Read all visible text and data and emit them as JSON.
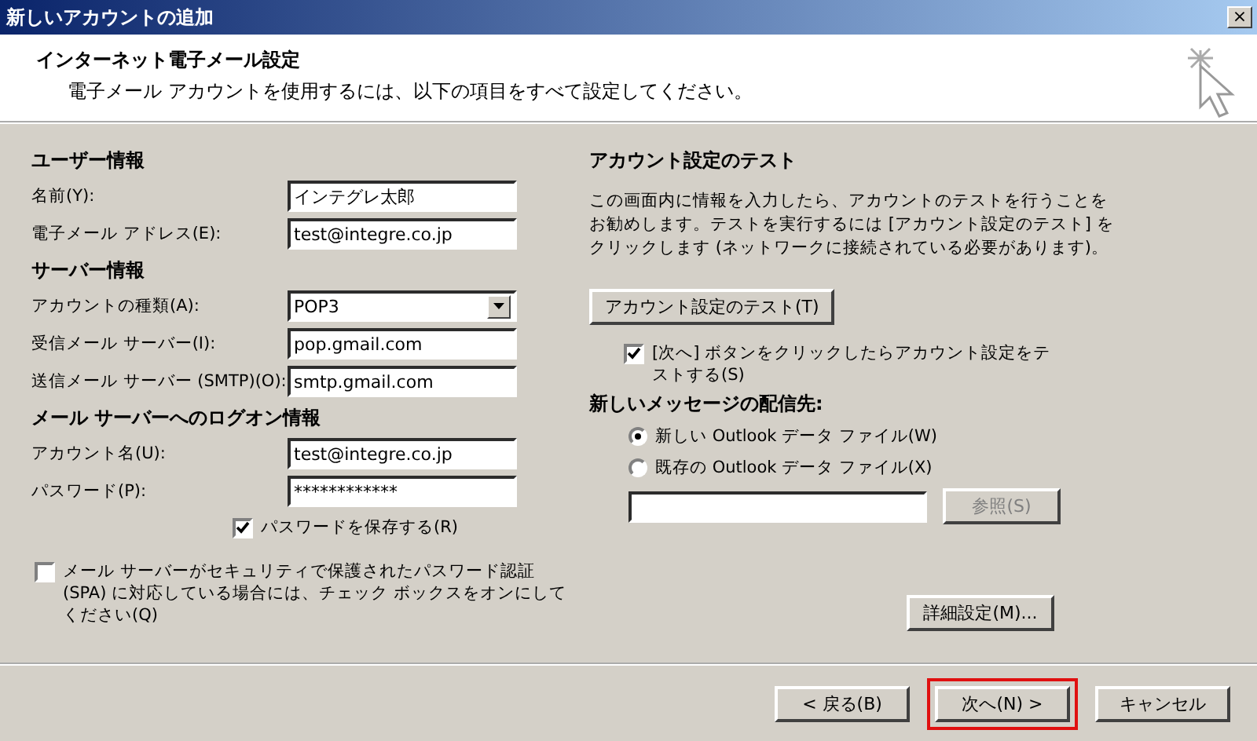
{
  "window": {
    "title": "新しいアカウントの追加",
    "close": "×"
  },
  "header": {
    "title": "インターネット電子メール設定",
    "subtitle": "電子メール アカウントを使用するには、以下の項目をすべて設定してください。"
  },
  "sections": [
    {
      "heading": "ユーザー情報",
      "fields": [
        {
          "label": "名前(Y):",
          "value": "インテグレ太郎",
          "kind": "text"
        },
        {
          "label": "電子メール アドレス(E):",
          "value": "test@integre.co.jp",
          "kind": "text"
        }
      ]
    },
    {
      "heading": "サーバー情報",
      "fields": [
        {
          "label": "アカウントの種類(A):",
          "value": "POP3",
          "kind": "select"
        },
        {
          "label": "受信メール サーバー(I):",
          "value": "pop.gmail.com",
          "kind": "text"
        },
        {
          "label": "送信メール サーバー (SMTP)(O):",
          "value": "smtp.gmail.com",
          "kind": "text"
        }
      ]
    },
    {
      "heading": "メール サーバーへのログオン情報",
      "fields": [
        {
          "label": "アカウント名(U):",
          "value": "test@integre.co.jp",
          "kind": "text"
        },
        {
          "label": "パスワード(P):",
          "value": "************",
          "kind": "text"
        }
      ]
    }
  ],
  "save_password": {
    "label": "パスワードを保存する(R)",
    "checked": true
  },
  "spa": {
    "label": "メール サーバーがセキュリティで保護されたパスワード認証 (SPA) に対応している場合には、チェック ボックスをオンにしてください(Q)",
    "checked": false
  },
  "test": {
    "heading": "アカウント設定のテスト",
    "description": "この画面内に情報を入力したら、アカウントのテストを行うことをお勧めします。テストを実行するには [アカウント設定のテスト] をクリックします (ネットワークに接続されている必要があります)。",
    "button": "アカウント設定のテスト(T)"
  },
  "test_on_next": {
    "label": "[次へ] ボタンをクリックしたらアカウント設定をテストする(S)",
    "checked": true
  },
  "delivery": {
    "heading": "新しいメッセージの配信先:",
    "options": [
      {
        "label": "新しい Outlook データ ファイル(W)",
        "selected": true
      },
      {
        "label": "既存の Outlook データ ファイル(X)",
        "selected": false
      }
    ],
    "browse_button": {
      "label": "参照(S)",
      "disabled": true
    }
  },
  "advanced_button": "詳細設定(M)...",
  "footer_buttons": [
    {
      "label": "< 戻る(B)",
      "highlighted": false
    },
    {
      "label": "次へ(N) >",
      "highlighted": true
    },
    {
      "label": "キャンセル",
      "highlighted": false
    }
  ]
}
